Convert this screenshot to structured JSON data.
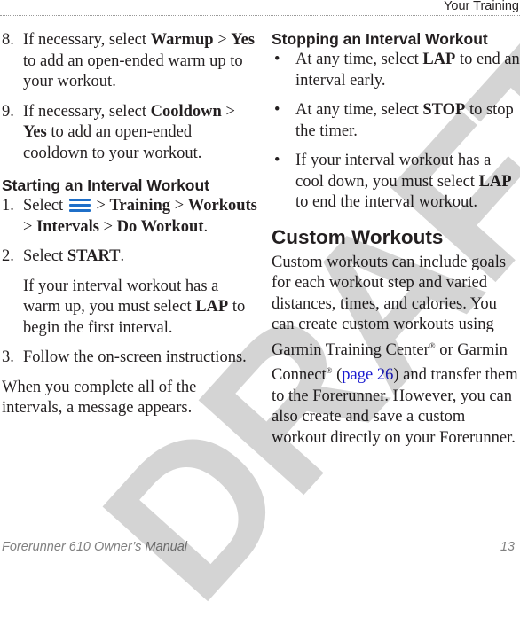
{
  "header": {
    "section_title": "Your Training"
  },
  "left_column": {
    "steps_continued": [
      {
        "number": "8.",
        "parts": [
          "If necessary, select ",
          "Warmup",
          " > ",
          "Yes",
          " to add an open-ended warm up to your workout."
        ]
      },
      {
        "number": "9.",
        "parts": [
          "If necessary, select ",
          "Cooldown",
          " > ",
          "Yes",
          " to add an open-ended cooldown to your workout."
        ]
      }
    ],
    "starting_heading": "Starting an Interval Workout",
    "starting_steps": [
      {
        "number": "1.",
        "select": "Select",
        "icon": "menu-icon",
        "path": [
          " > ",
          "Training",
          " > ",
          "Workouts",
          " > ",
          "Intervals",
          " > ",
          "Do Workout",
          "."
        ]
      },
      {
        "number": "2.",
        "parts": [
          "Select ",
          "START",
          "."
        ],
        "note": [
          "If your interval workout has a warm up, you must select ",
          "LAP",
          " to begin the first interval."
        ]
      },
      {
        "number": "3.",
        "text": "Follow the on-screen instructions."
      }
    ],
    "closing": "When you complete all of the intervals, a message appears."
  },
  "right_column": {
    "stopping_heading": "Stopping an Interval Workout",
    "bullet_char": "•",
    "bullets": [
      {
        "parts": [
          "At any time, select ",
          "LAP",
          " to end an interval early."
        ]
      },
      {
        "parts": [
          "At any time, select ",
          "STOP",
          " to stop the timer."
        ]
      },
      {
        "parts": [
          "If your interval workout has a cool down, you must select ",
          "LAP",
          " to end the interval workout."
        ]
      }
    ],
    "custom_heading": "Custom Workouts",
    "custom_text": {
      "a": "Custom workouts can include goals for each workout step and varied distances, times, and calories. You can create custom workouts using Garmin Training Center",
      "reg1": "®",
      "b": " or Garmin Connect",
      "reg2": "®",
      "c": " (",
      "link": "page 26",
      "d": ") and transfer them to the Forerunner. However, you can also create and save a custom workout directly on your Forerunner."
    }
  },
  "footer": {
    "manual_title": "Forerunner 610 Owner’s Manual",
    "page_number": "13"
  },
  "watermark": {
    "text": "DRAFT"
  },
  "colors": {
    "link": "#1a1ad0",
    "menu_icon": "#1f6fc8",
    "watermark": "#d0d0d0",
    "footer": "#808080"
  }
}
